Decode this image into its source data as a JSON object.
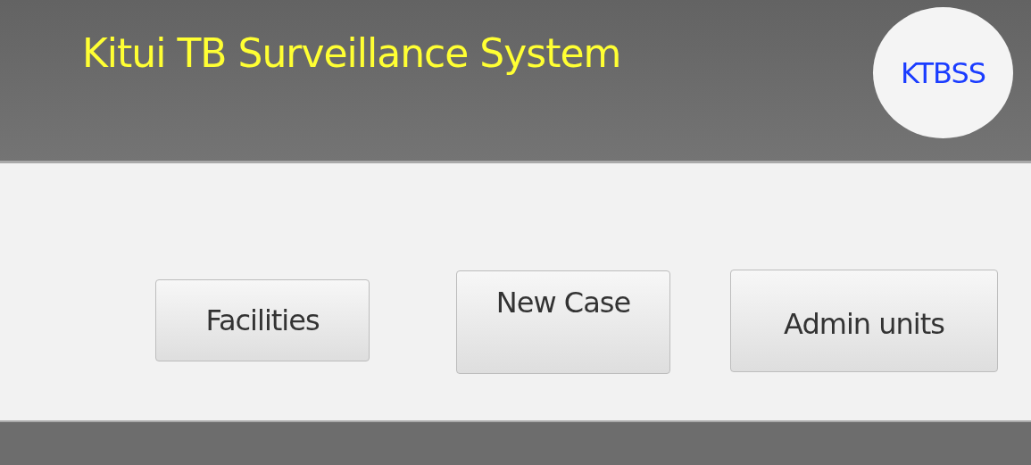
{
  "header": {
    "title": "Kitui TB Surveillance System",
    "logo": "KTBSS"
  },
  "buttons": [
    "Facilities",
    "New Case",
    "Admin units"
  ]
}
